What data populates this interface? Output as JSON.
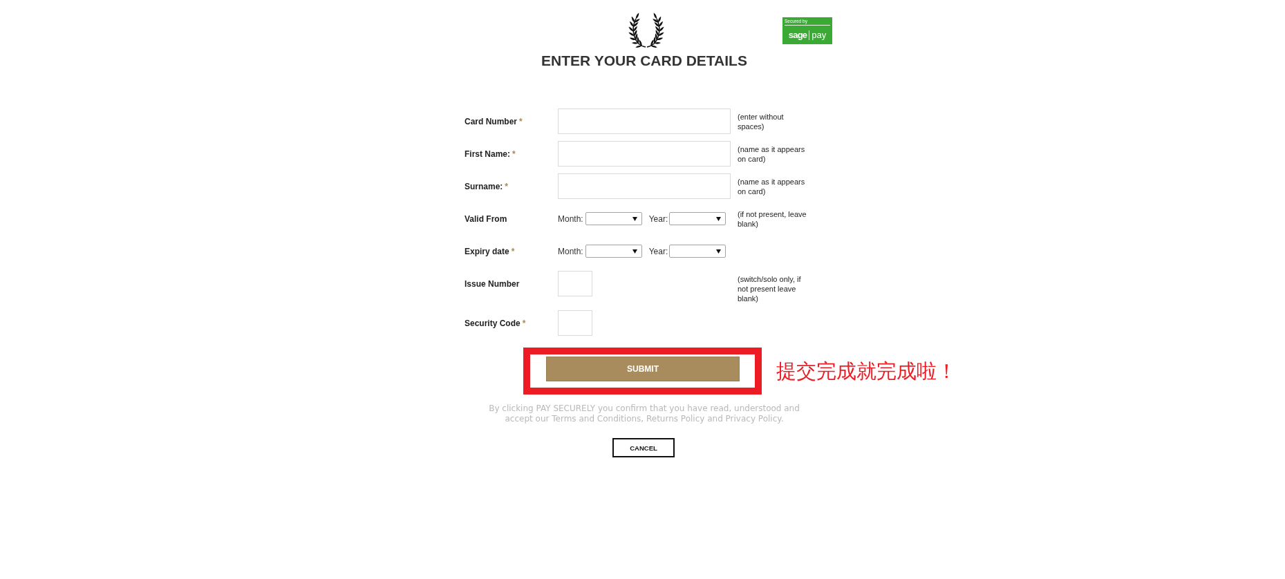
{
  "header": {
    "badge": {
      "caption": "Secured by",
      "wordmark_left": "sage",
      "wordmark_right": "pay"
    },
    "title": "ENTER YOUR CARD DETAILS"
  },
  "form": {
    "fields": [
      {
        "kind": "text",
        "label": "Card Number",
        "marker": "*",
        "hint": "(enter without spaces)"
      },
      {
        "kind": "text",
        "label": "First Name:",
        "marker": "*",
        "hint": "(name as it appears on card)"
      },
      {
        "kind": "text",
        "label": "Surname:",
        "marker": "*",
        "hint": "(name as it appears on card)"
      },
      {
        "kind": "date",
        "label": "Valid From",
        "month_label": "Month:",
        "year_label": "Year:",
        "hint": "(if not present, leave blank)"
      },
      {
        "kind": "date",
        "label": "Expiry date",
        "marker": "*",
        "month_label": "Month:",
        "year_label": "Year:"
      },
      {
        "kind": "short",
        "label": "Issue Number",
        "hint": "(switch/solo only, if not present leave blank)"
      },
      {
        "kind": "short",
        "label": "Security Code",
        "marker": "*"
      }
    ]
  },
  "submit": {
    "button": "SUBMIT",
    "annotation": "提交完成就完成啦！"
  },
  "disclaimer": "By clicking PAY SECURELY you confirm that you have read, understood and accept our Terms and Conditions, Returns Policy and Privacy Policy.",
  "cancel_button": "CANCEL"
}
